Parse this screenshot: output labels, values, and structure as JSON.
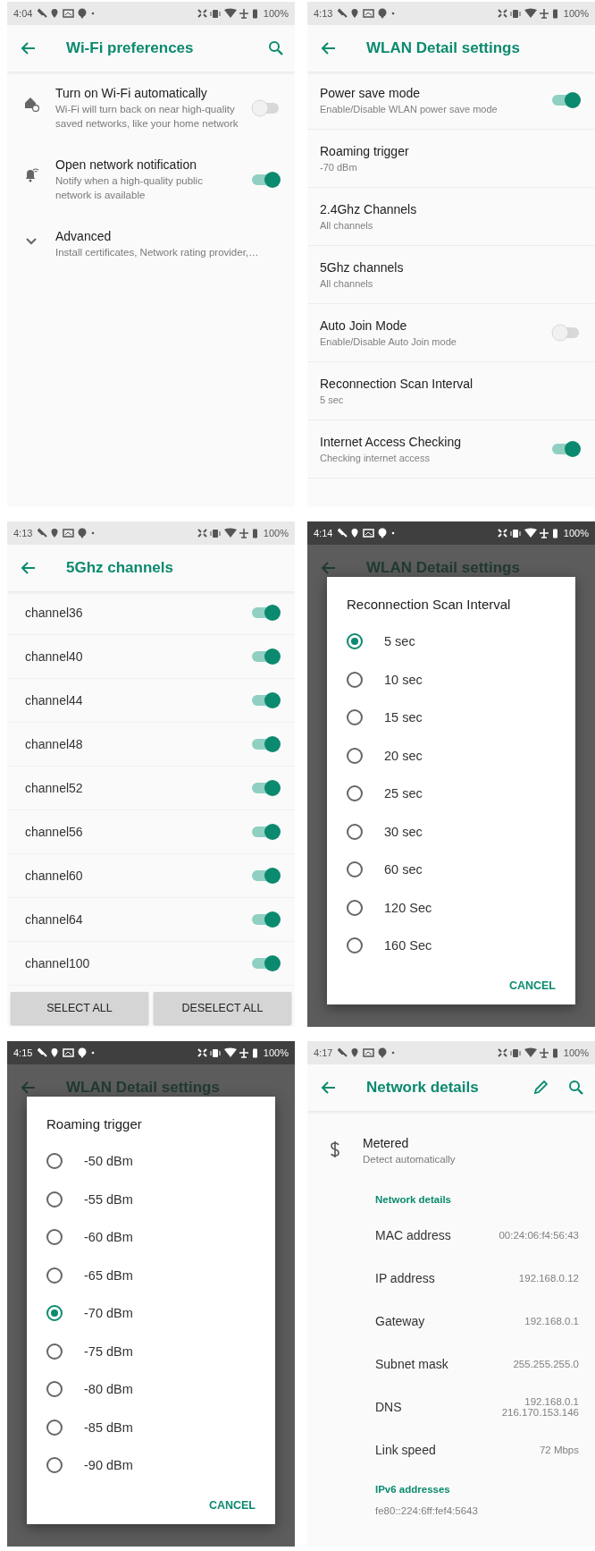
{
  "screens": [
    {
      "kind": "preferences",
      "status_bar": {
        "time": "4:04",
        "battery": "100%"
      },
      "title": "Wi-Fi preferences",
      "items": [
        {
          "kind": "switch",
          "title": "Turn on Wi-Fi automatically",
          "summary": "Wi-Fi will turn back on near high-quality saved networks, like your home network",
          "on": false
        },
        {
          "kind": "switch",
          "title": "Open network notification",
          "summary": "Notify when a high-quality public network is available",
          "on": true
        },
        {
          "kind": "expand",
          "title": "Advanced",
          "summary": "Install certificates, Network rating provider,…"
        }
      ]
    },
    {
      "kind": "detail_list",
      "status_bar": {
        "time": "4:13",
        "battery": "100%"
      },
      "title": "WLAN Detail settings",
      "items": [
        {
          "kind": "switch",
          "title": "Power save mode",
          "summary": "Enable/Disable WLAN power save mode",
          "on": true
        },
        {
          "kind": "value",
          "title": "Roaming trigger",
          "summary": "-70 dBm"
        },
        {
          "kind": "value",
          "title": "2.4Ghz Channels",
          "summary": "All channels"
        },
        {
          "kind": "value",
          "title": "5Ghz channels",
          "summary": "All channels"
        },
        {
          "kind": "switch",
          "title": "Auto Join Mode",
          "summary": "Enable/Disable Auto Join mode",
          "on": false
        },
        {
          "kind": "value",
          "title": "Reconnection Scan Interval",
          "summary": "5 sec"
        },
        {
          "kind": "switch",
          "title": "Internet Access Checking",
          "summary": "Checking internet access",
          "on": true
        }
      ]
    },
    {
      "kind": "channel_list",
      "status_bar": {
        "time": "4:13",
        "battery": "100%"
      },
      "title": "5Ghz channels",
      "channels": [
        {
          "name": "channel36",
          "on": true
        },
        {
          "name": "channel40",
          "on": true
        },
        {
          "name": "channel44",
          "on": true
        },
        {
          "name": "channel48",
          "on": true
        },
        {
          "name": "channel52",
          "on": true
        },
        {
          "name": "channel56",
          "on": true
        },
        {
          "name": "channel60",
          "on": true
        },
        {
          "name": "channel64",
          "on": true
        },
        {
          "name": "channel100",
          "on": true
        }
      ],
      "buttons": [
        "SELECT ALL",
        "DESELECT ALL"
      ]
    },
    {
      "kind": "dialog",
      "status_bar": {
        "time": "4:14",
        "battery": "100%"
      },
      "title": "WLAN Detail settings",
      "dialog": {
        "title": "Reconnection Scan Interval",
        "options": [
          {
            "label": "5 sec",
            "selected": true
          },
          {
            "label": "10 sec",
            "selected": false
          },
          {
            "label": "15 sec",
            "selected": false
          },
          {
            "label": "20 sec",
            "selected": false
          },
          {
            "label": "25 sec",
            "selected": false
          },
          {
            "label": "30 sec",
            "selected": false
          },
          {
            "label": "60 sec",
            "selected": false
          },
          {
            "label": "120 Sec",
            "selected": false
          },
          {
            "label": "160 Sec",
            "selected": false
          }
        ],
        "button": "CANCEL"
      }
    },
    {
      "kind": "dialog",
      "status_bar": {
        "time": "4:15",
        "battery": "100%"
      },
      "title": "WLAN Detail settings",
      "dialog": {
        "title": "Roaming trigger",
        "options": [
          {
            "label": "-50 dBm",
            "selected": false
          },
          {
            "label": "-55 dBm",
            "selected": false
          },
          {
            "label": "-60 dBm",
            "selected": false
          },
          {
            "label": "-65 dBm",
            "selected": false
          },
          {
            "label": "-70 dBm",
            "selected": true
          },
          {
            "label": "-75 dBm",
            "selected": false
          },
          {
            "label": "-80 dBm",
            "selected": false
          },
          {
            "label": "-85 dBm",
            "selected": false
          },
          {
            "label": "-90 dBm",
            "selected": false
          }
        ],
        "button": "CANCEL"
      }
    },
    {
      "kind": "network_details",
      "status_bar": {
        "time": "4:17",
        "battery": "100%"
      },
      "title": "Network details",
      "metered": {
        "title": "Metered",
        "summary": "Detect automatically"
      },
      "sections": [
        {
          "header": "Network details",
          "rows": [
            {
              "label": "MAC address",
              "value": "00:24:06:f4:56:43"
            },
            {
              "label": "IP address",
              "value": "192.168.0.12"
            },
            {
              "label": "Gateway",
              "value": "192.168.0.1"
            },
            {
              "label": "Subnet mask",
              "value": "255.255.255.0"
            },
            {
              "label": "DNS",
              "value": "192.168.0.1\n216.170.153.146"
            },
            {
              "label": "Link speed",
              "value": "72 Mbps"
            }
          ]
        },
        {
          "header": "IPv6 addresses",
          "rows": [
            {
              "value": "fe80::224:6ff:fef4:5643"
            }
          ]
        }
      ]
    }
  ]
}
